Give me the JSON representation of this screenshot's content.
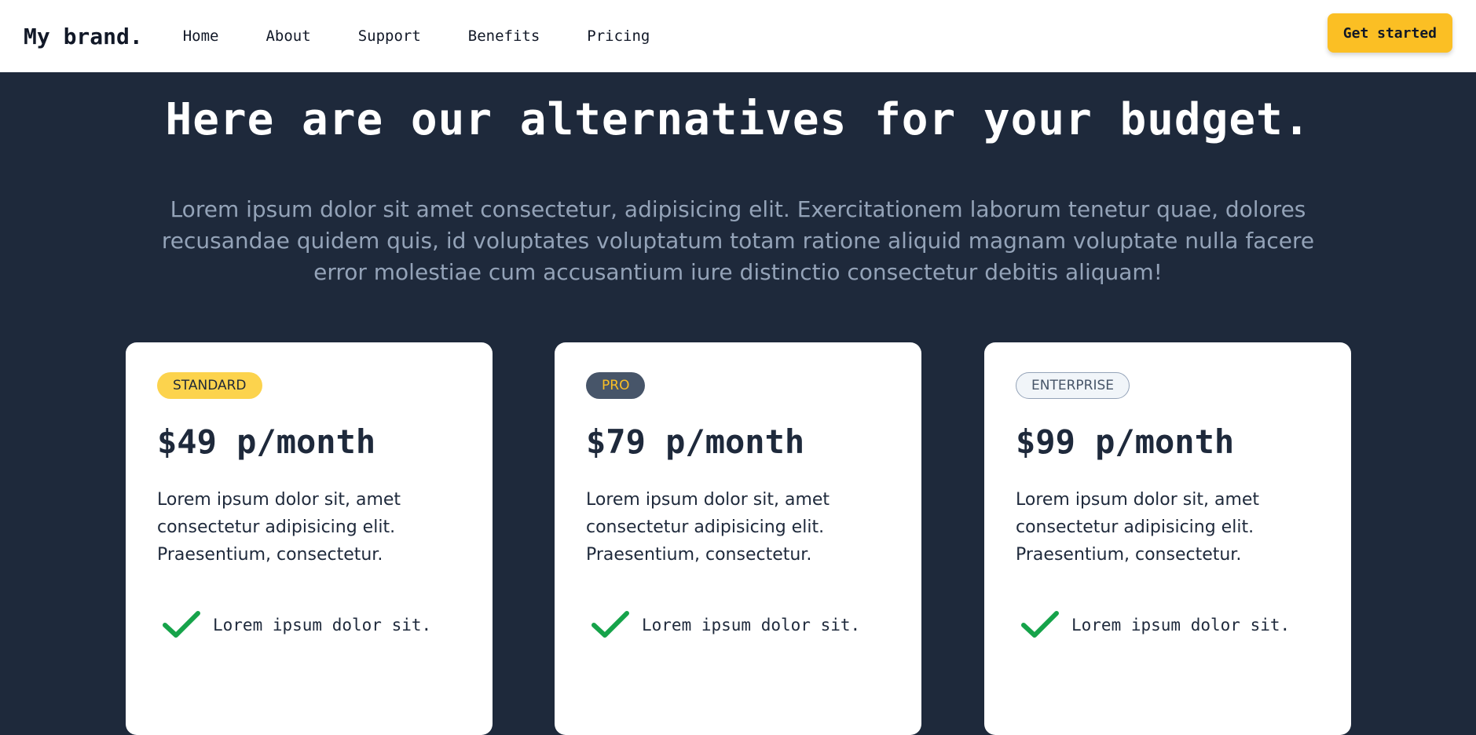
{
  "header": {
    "brand": "My brand.",
    "nav": [
      "Home",
      "About",
      "Support",
      "Benefits",
      "Pricing"
    ],
    "cta_label": "Get started"
  },
  "hero": {
    "title": "Here are our alternatives for your budget.",
    "subtitle": "Lorem ipsum dolor sit amet consectetur, adipisicing elit. Exercitationem laborum tenetur quae, dolores recusandae quidem quis, id voluptates voluptatum totam ratione aliquid magnam voluptate nulla facere error molestiae cum accusantium iure distinctio consectetur debitis aliquam!"
  },
  "plans": [
    {
      "badge": "STANDARD",
      "price": "$49 p/month",
      "description": "Lorem ipsum dolor sit, amet consectetur adipisicing elit. Praesentium, consectetur.",
      "feature": "Lorem ipsum dolor sit."
    },
    {
      "badge": "PRO",
      "price": "$79 p/month",
      "description": "Lorem ipsum dolor sit, amet consectetur adipisicing elit. Praesentium, consectetur.",
      "feature": "Lorem ipsum dolor sit."
    },
    {
      "badge": "ENTERPRISE",
      "price": "$99 p/month",
      "description": "Lorem ipsum dolor sit, amet consectetur adipisicing elit. Praesentium, consectetur.",
      "feature": "Lorem ipsum dolor sit."
    }
  ],
  "icons": {
    "feature_check": "check-icon"
  },
  "colors": {
    "page_background": "#1e293b",
    "accent": "#fbbf24",
    "check": "#16a34a",
    "subtitle": "#94a3b8"
  }
}
